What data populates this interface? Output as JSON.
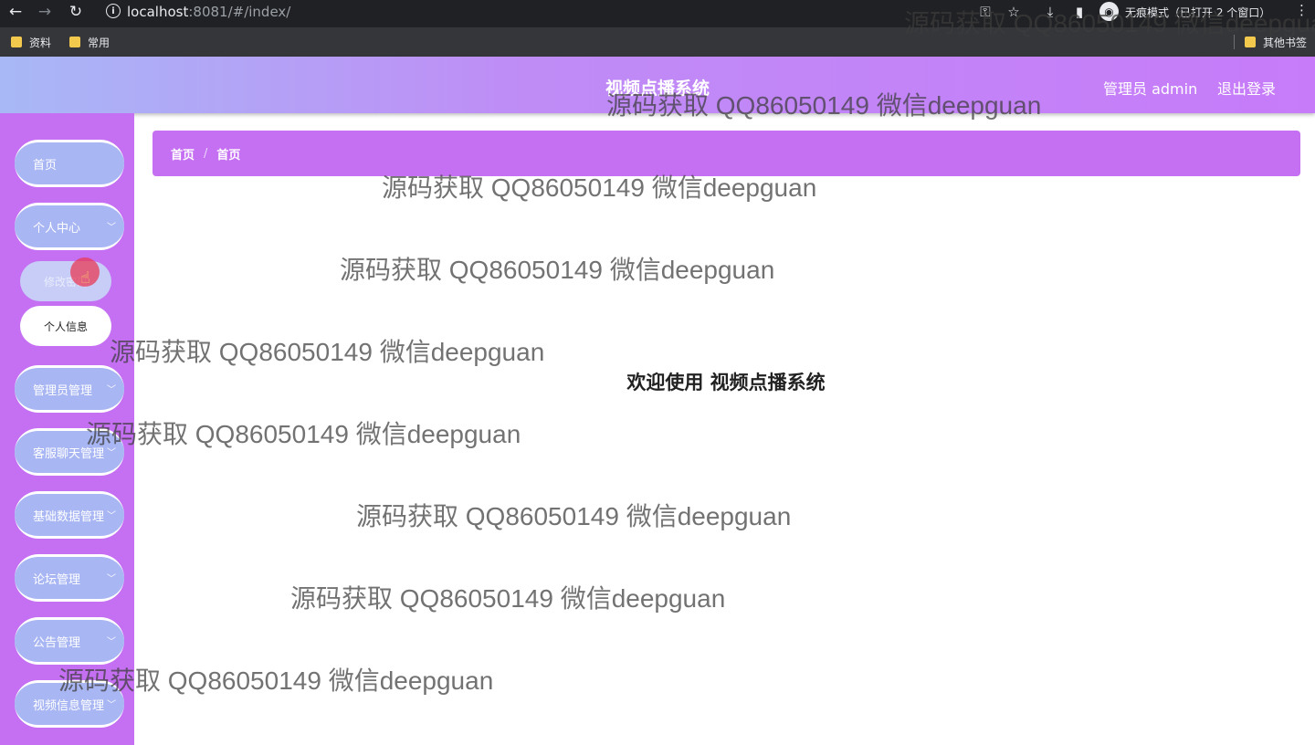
{
  "browser": {
    "url_host": "localhost",
    "url_rest": ":8081/#/index/",
    "incognito_text": "无痕模式（已打开 2 个窗口）",
    "bookmarks": [
      "资料",
      "常用"
    ],
    "other_bookmarks": "其他书签"
  },
  "header": {
    "title": "视频点播系统",
    "user_label": "管理员 admin",
    "logout": "退出登录"
  },
  "sidebar": {
    "items": [
      {
        "label": "首页",
        "has_chevron": false
      },
      {
        "label": "个人中心",
        "has_chevron": true
      },
      {
        "label": "管理员管理",
        "has_chevron": true
      },
      {
        "label": "客服聊天管理",
        "has_chevron": true
      },
      {
        "label": "基础数据管理",
        "has_chevron": true
      },
      {
        "label": "论坛管理",
        "has_chevron": true
      },
      {
        "label": "公告管理",
        "has_chevron": true
      },
      {
        "label": "视频信息管理",
        "has_chevron": true
      }
    ],
    "subitems": [
      "修改密码",
      "个人信息"
    ]
  },
  "breadcrumb": [
    "首页",
    "首页"
  ],
  "welcome": "欢迎使用 视频点播系统",
  "watermark": "源码获取 QQ86050149 微信deepguan",
  "colors": {
    "sidebar": "#c56ff2",
    "menu_item": "#a9b6f4",
    "header_start": "#a8b8f6",
    "header_end": "#c77bf9"
  }
}
